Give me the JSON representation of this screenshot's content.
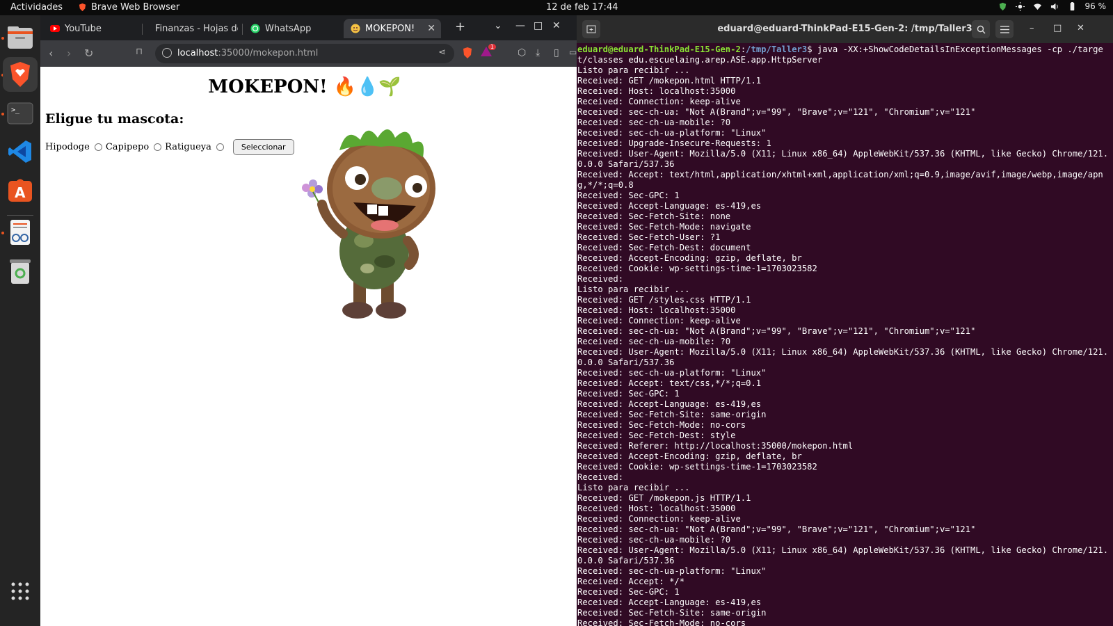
{
  "topbar": {
    "activities": "Actividades",
    "app_name": "Brave Web Browser",
    "clock": "12 de feb  17:44",
    "battery": "96 %"
  },
  "dock": {
    "items": [
      "files-icon",
      "brave-icon",
      "terminal-icon",
      "vscode-icon",
      "app-center-icon",
      "document-viewer-icon",
      "trash-icon",
      "app-grid-icon"
    ]
  },
  "browser": {
    "tabs": [
      {
        "label": "YouTube",
        "icon": "youtube-icon"
      },
      {
        "label": "Finanzas - Hojas de",
        "icon": "sheets-icon"
      },
      {
        "label": "WhatsApp",
        "icon": "whatsapp-icon"
      },
      {
        "label": "MOKEPON!",
        "icon": "emoji-icon"
      }
    ],
    "url_host": "localhost",
    "url_rest": ":35000/mokepon.html",
    "shields_count": "1"
  },
  "page": {
    "title": "MOKEPON! 🔥💧🌱",
    "subtitle": "Eligue tu mascota:",
    "options": [
      "Hipodoge",
      "Capipepo",
      "Ratigueya"
    ],
    "button": "Seleccionar"
  },
  "terminal": {
    "title": "eduard@eduard-ThinkPad-E15-Gen-2: /tmp/Taller3",
    "prompt_user": "eduard@eduard-ThinkPad-E15-Gen-2",
    "prompt_path": "/tmp/Taller3",
    "command": "$ java -XX:+ShowCodeDetailsInExceptionMessages -cp ./target/classes edu.escuelaing.arep.ASE.app.HttpServer",
    "lines": [
      "Listo para recibir ...",
      "Received: GET /mokepon.html HTTP/1.1",
      "Received: Host: localhost:35000",
      "Received: Connection: keep-alive",
      "Received: sec-ch-ua: \"Not A(Brand\";v=\"99\", \"Brave\";v=\"121\", \"Chromium\";v=\"121\"",
      "Received: sec-ch-ua-mobile: ?0",
      "Received: sec-ch-ua-platform: \"Linux\"",
      "Received: Upgrade-Insecure-Requests: 1",
      "Received: User-Agent: Mozilla/5.0 (X11; Linux x86_64) AppleWebKit/537.36 (KHTML, like Gecko) Chrome/121.0.0.0 Safari/537.36",
      "Received: Accept: text/html,application/xhtml+xml,application/xml;q=0.9,image/avif,image/webp,image/apng,*/*;q=0.8",
      "Received: Sec-GPC: 1",
      "Received: Accept-Language: es-419,es",
      "Received: Sec-Fetch-Site: none",
      "Received: Sec-Fetch-Mode: navigate",
      "Received: Sec-Fetch-User: ?1",
      "Received: Sec-Fetch-Dest: document",
      "Received: Accept-Encoding: gzip, deflate, br",
      "Received: Cookie: wp-settings-time-1=1703023582",
      "Received: ",
      "Listo para recibir ...",
      "Received: GET /styles.css HTTP/1.1",
      "Received: Host: localhost:35000",
      "Received: Connection: keep-alive",
      "Received: sec-ch-ua: \"Not A(Brand\";v=\"99\", \"Brave\";v=\"121\", \"Chromium\";v=\"121\"",
      "Received: sec-ch-ua-mobile: ?0",
      "Received: User-Agent: Mozilla/5.0 (X11; Linux x86_64) AppleWebKit/537.36 (KHTML, like Gecko) Chrome/121.0.0.0 Safari/537.36",
      "Received: sec-ch-ua-platform: \"Linux\"",
      "Received: Accept: text/css,*/*;q=0.1",
      "Received: Sec-GPC: 1",
      "Received: Accept-Language: es-419,es",
      "Received: Sec-Fetch-Site: same-origin",
      "Received: Sec-Fetch-Mode: no-cors",
      "Received: Sec-Fetch-Dest: style",
      "Received: Referer: http://localhost:35000/mokepon.html",
      "Received: Accept-Encoding: gzip, deflate, br",
      "Received: Cookie: wp-settings-time-1=1703023582",
      "Received: ",
      "Listo para recibir ...",
      "Received: GET /mokepon.js HTTP/1.1",
      "Received: Host: localhost:35000",
      "Received: Connection: keep-alive",
      "Received: sec-ch-ua: \"Not A(Brand\";v=\"99\", \"Brave\";v=\"121\", \"Chromium\";v=\"121\"",
      "Received: sec-ch-ua-mobile: ?0",
      "Received: User-Agent: Mozilla/5.0 (X11; Linux x86_64) AppleWebKit/537.36 (KHTML, like Gecko) Chrome/121.0.0.0 Safari/537.36",
      "Received: sec-ch-ua-platform: \"Linux\"",
      "Received: Accept: */*",
      "Received: Sec-GPC: 1",
      "Received: Accept-Language: es-419,es",
      "Received: Sec-Fetch-Site: same-origin",
      "Received: Sec-Fetch-Mode: no-cors"
    ]
  }
}
